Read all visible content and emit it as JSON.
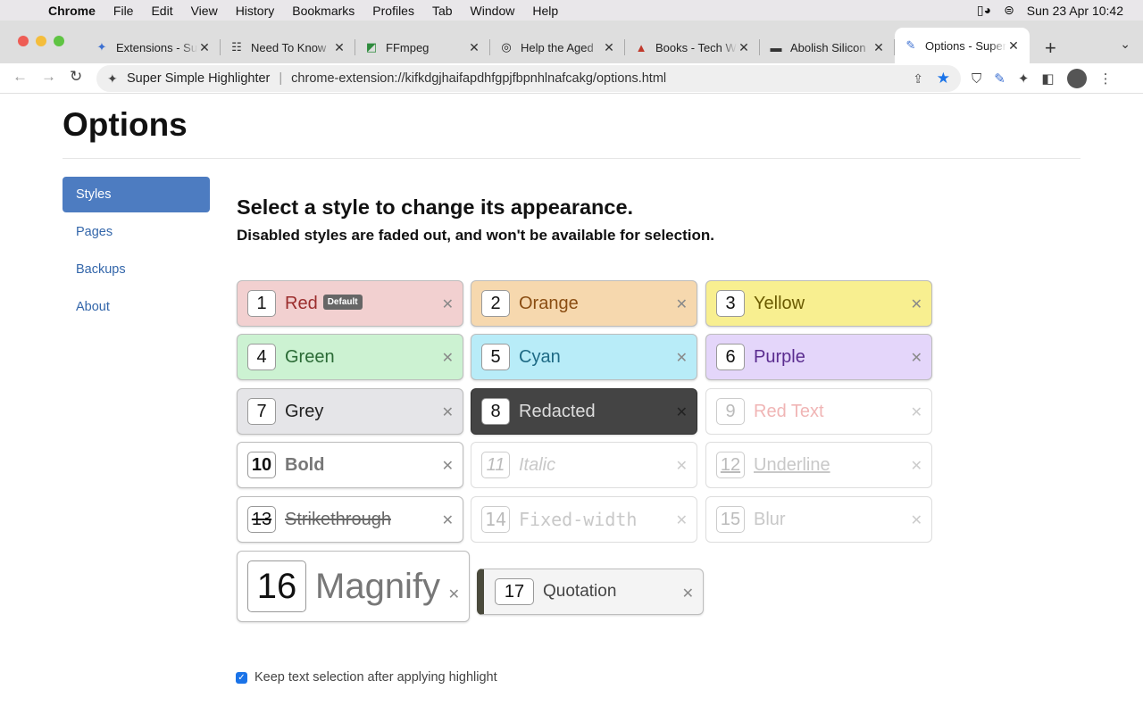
{
  "menubar": {
    "app": "Chrome",
    "items": [
      "File",
      "Edit",
      "View",
      "History",
      "Bookmarks",
      "Profiles",
      "Tab",
      "Window",
      "Help"
    ],
    "clock": "Sun 23 Apr  10:42"
  },
  "tabs": [
    {
      "title": "Extensions - Super Simple Highlighter",
      "icon": "puzzle-icon",
      "fav": "✦",
      "color": "#3b6fd1"
    },
    {
      "title": "Need To Know",
      "icon": "newspaper-icon",
      "fav": "☷",
      "color": "#333333"
    },
    {
      "title": "FFmpeg",
      "icon": "ffmpeg-icon",
      "fav": "◩",
      "color": "#2e8b3d"
    },
    {
      "title": "Help the Aged",
      "icon": "target-icon",
      "fav": "◎",
      "color": "#222222"
    },
    {
      "title": "Books - Tech W",
      "icon": "triangle-icon",
      "fav": "▲",
      "color": "#c0392b"
    },
    {
      "title": "Abolish Silicon",
      "icon": "car-icon",
      "fav": "▬",
      "color": "#333333"
    },
    {
      "title": "Options - Super Simple Highlighter",
      "icon": "highlighter-icon",
      "fav": "✎",
      "color": "#3b6fd1",
      "active": true
    }
  ],
  "toolbar": {
    "extension_name": "Super Simple Highlighter",
    "url": "chrome-extension://kifkdgjhaifapdhfgpjfbpnhlnafcakg/options.html"
  },
  "page": {
    "title": "Options",
    "heading": "Select a style to change its appearance.",
    "subheading": "Disabled styles are faded out, and won't be available for selection.",
    "nav": [
      "Styles",
      "Pages",
      "Backups",
      "About"
    ],
    "checkbox_label": "Keep text selection after applying highlight",
    "default_badge": "Default"
  },
  "styles": [
    {
      "num": "1",
      "label": "Red",
      "bg": "#f2d0d0",
      "fg": "#9b2d2d",
      "enabled": true,
      "is_default": true
    },
    {
      "num": "2",
      "label": "Orange",
      "bg": "#f6d8ae",
      "fg": "#8a4d12",
      "enabled": true
    },
    {
      "num": "3",
      "label": "Yellow",
      "bg": "#f8ef90",
      "fg": "#6a5a00",
      "enabled": true
    },
    {
      "num": "4",
      "label": "Green",
      "bg": "#ccf2d2",
      "fg": "#2a6a35",
      "enabled": true
    },
    {
      "num": "5",
      "label": "Cyan",
      "bg": "#b8ecf8",
      "fg": "#1e6a85",
      "enabled": true
    },
    {
      "num": "6",
      "label": "Purple",
      "bg": "#e4d6fa",
      "fg": "#5a2c8f",
      "enabled": true
    },
    {
      "num": "7",
      "label": "Grey",
      "bg": "#e5e5e8",
      "fg": "#222222",
      "enabled": true
    },
    {
      "num": "8",
      "label": "Redacted",
      "bg": "#444444",
      "fg": "#dddddd",
      "enabled": true
    },
    {
      "num": "9",
      "label": "Red Text",
      "bg": "#ffffff",
      "fg": "#f0b5b5",
      "enabled": false
    },
    {
      "num": "10",
      "label": "Bold",
      "bg": "#ffffff",
      "fg": "#777777",
      "enabled": true
    },
    {
      "num": "11",
      "label": "Italic",
      "bg": "#ffffff",
      "fg": "#c8c8c8",
      "enabled": false
    },
    {
      "num": "12",
      "label": "Underline",
      "bg": "#ffffff",
      "fg": "#c8c8c8",
      "enabled": false
    },
    {
      "num": "13",
      "label": "Strikethrough",
      "bg": "#ffffff",
      "fg": "#666666",
      "enabled": true
    },
    {
      "num": "14",
      "label": "Fixed-width",
      "bg": "#ffffff",
      "fg": "#c8c8c8",
      "enabled": false
    },
    {
      "num": "15",
      "label": "Blur",
      "bg": "#ffffff",
      "fg": "#c8c8c8",
      "enabled": false
    },
    {
      "num": "16",
      "label": "Magnify",
      "bg": "#ffffff",
      "fg": "#777777",
      "enabled": true
    },
    {
      "num": "17",
      "label": "Quotation",
      "bg": "#f4f4f4",
      "fg": "#444444",
      "enabled": true
    }
  ]
}
